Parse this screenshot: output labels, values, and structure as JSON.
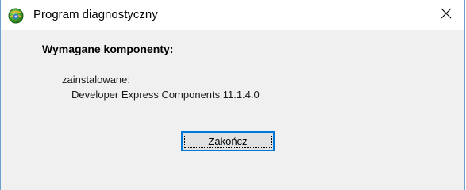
{
  "window": {
    "title": "Program diagnostyczny",
    "icon": "app-globe-icon",
    "close_icon": "close-icon"
  },
  "main": {
    "heading": "Wymagane komponenty:",
    "status_label": "zainstalowane:",
    "components": [
      "Developer Express Components 11.1.4.0"
    ],
    "finish_label": "Zakończ"
  },
  "colors": {
    "accent": "#0078d7",
    "window_border": "#6d9fcf",
    "dialog_bg": "#f0f0f0"
  }
}
